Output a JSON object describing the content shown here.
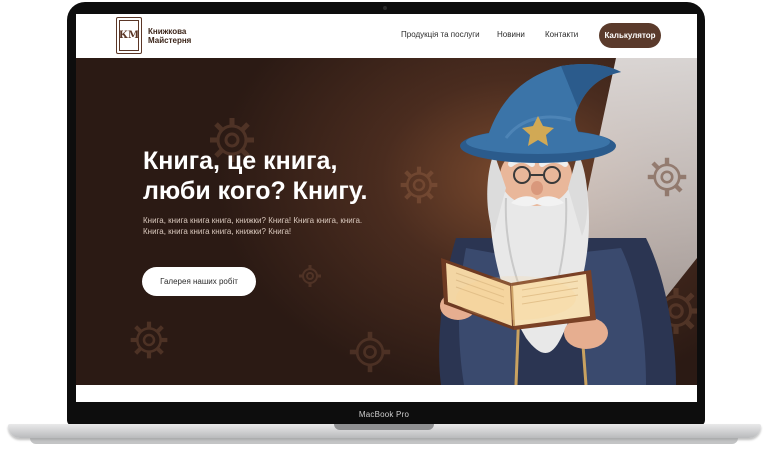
{
  "device": {
    "model_label": "MacBook Pro"
  },
  "header": {
    "logo_text_line1": "Книжкова",
    "logo_text_line2": "Майстерня",
    "logo_monogram": "КМ",
    "nav": [
      {
        "label": "Продукція та послуги"
      },
      {
        "label": "Новини"
      },
      {
        "label": "Контакти"
      }
    ],
    "cta_label": "Калькулятор"
  },
  "hero": {
    "title_line1": "Книга, це книга,",
    "title_line2": "люби кого? Книгу.",
    "subtitle_line1": "Книга, книга книга книга, книжки? Книга! Книга книга, книга.",
    "subtitle_line2": "Книга, книга книга книга, книжки? Книга!",
    "button_label": "Галерея наших робіт"
  },
  "colors": {
    "brand_brown": "#5a3a2b",
    "hero_dark": "#2b1a14",
    "hat_blue": "#2f5f8f"
  },
  "icons": [
    "gear-icon",
    "wizard-illustration",
    "book-logo-icon"
  ]
}
